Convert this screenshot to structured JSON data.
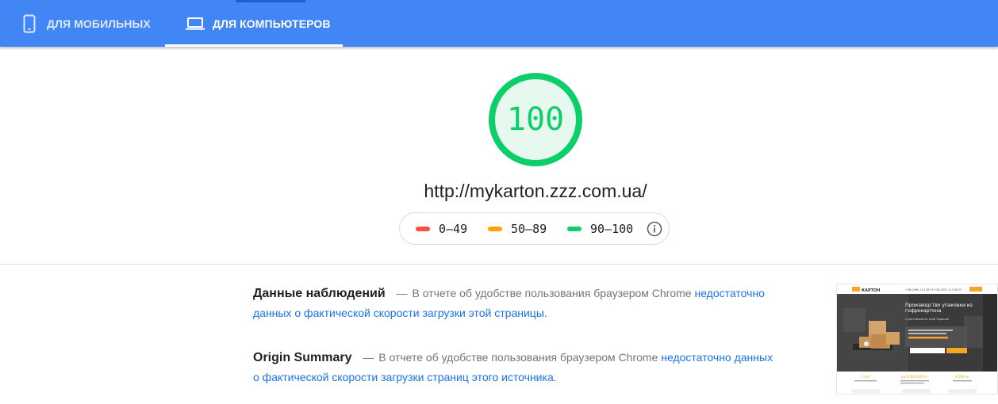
{
  "tabs": {
    "mobile": {
      "label": "ДЛЯ МОБИЛЬНЫХ",
      "icon": "smartphone-icon"
    },
    "desktop": {
      "label": "ДЛЯ КОМПЬЮТЕРОВ",
      "icon": "laptop-icon",
      "active": true
    }
  },
  "score": {
    "value": "100",
    "fraction": 1.0,
    "color": "#0cce6b"
  },
  "url": "http://mykarton.zzz.com.ua/",
  "legend": {
    "items": [
      {
        "label": "0–49",
        "color": "#ff4e42"
      },
      {
        "label": "50–89",
        "color": "#ffa400"
      },
      {
        "label": "90–100",
        "color": "#0cce6b"
      }
    ],
    "info_icon": "info-icon"
  },
  "field_data": {
    "title": "Данные наблюдений",
    "dash": "—",
    "text": "В отчете об удобстве пользования браузером Chrome ",
    "link": "недостаточно данных о фактической скорости загрузки этой страницы",
    "end": "."
  },
  "origin_summary": {
    "title": "Origin Summary",
    "dash": "—",
    "text": "В отчете об удобстве пользования браузером Chrome ",
    "link": "недостаточно данных о фактической скорости загрузки страниц этого источника",
    "end": "."
  },
  "screenshot": {
    "logo": "КАРТОН",
    "phone1": "+38 (098) 213 48 97",
    "phone2": "+38 (097) 213 48 97",
    "headline_1": "Производство упаковки из",
    "headline_2": "гофрокартона",
    "subline": "с доставкой по всей Украине",
    "stat1": "5 лет",
    "stat2": "до 8 000 000 м²",
    "stat3": "4 000 м²",
    "colors": {
      "accent": "#f5a623",
      "dark": "#3b3b3b"
    }
  }
}
